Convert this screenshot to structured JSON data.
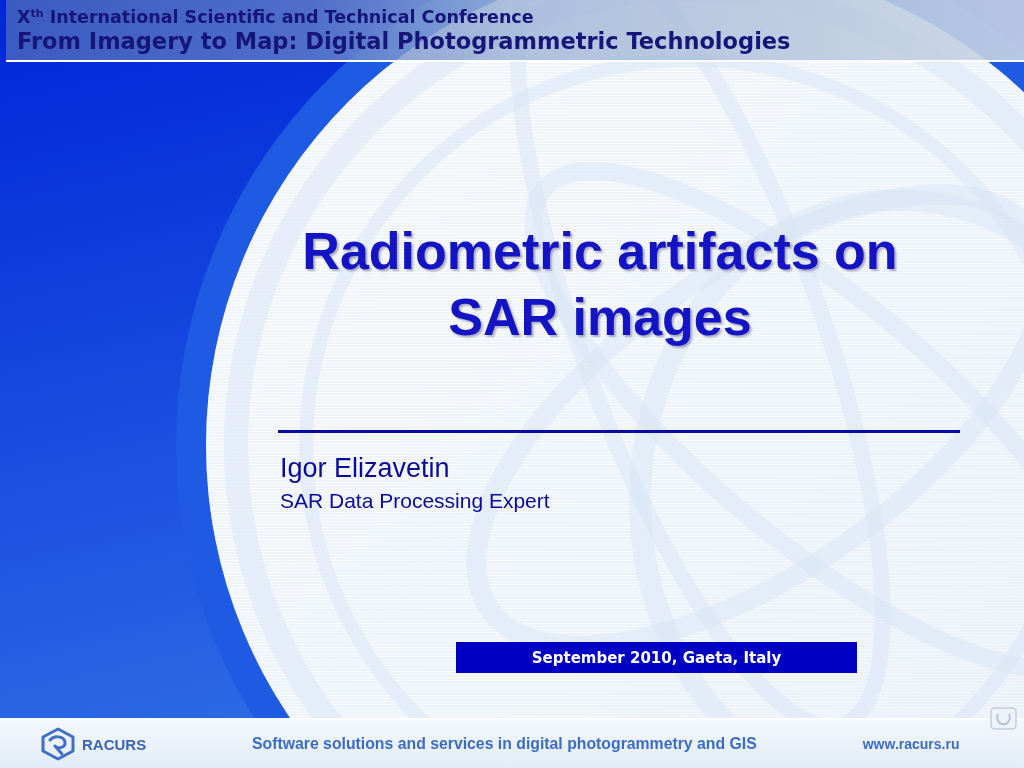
{
  "header": {
    "conference": "X$^{th}$ International Scientific and Technical Conference",
    "event": "From Imagery to Map: Digital Photogrammetric Technologies"
  },
  "title": "Radiometric artifacts on SAR images",
  "author": {
    "name": "Igor Elizavetin",
    "role": "SAR Data Processing Expert"
  },
  "date_banner": "September 2010, Gaeta, Italy",
  "footer": {
    "logo": "RACURS",
    "tagline": "Software solutions and services in digital photogrammetry and GIS",
    "url": "www.racurs.ru"
  }
}
